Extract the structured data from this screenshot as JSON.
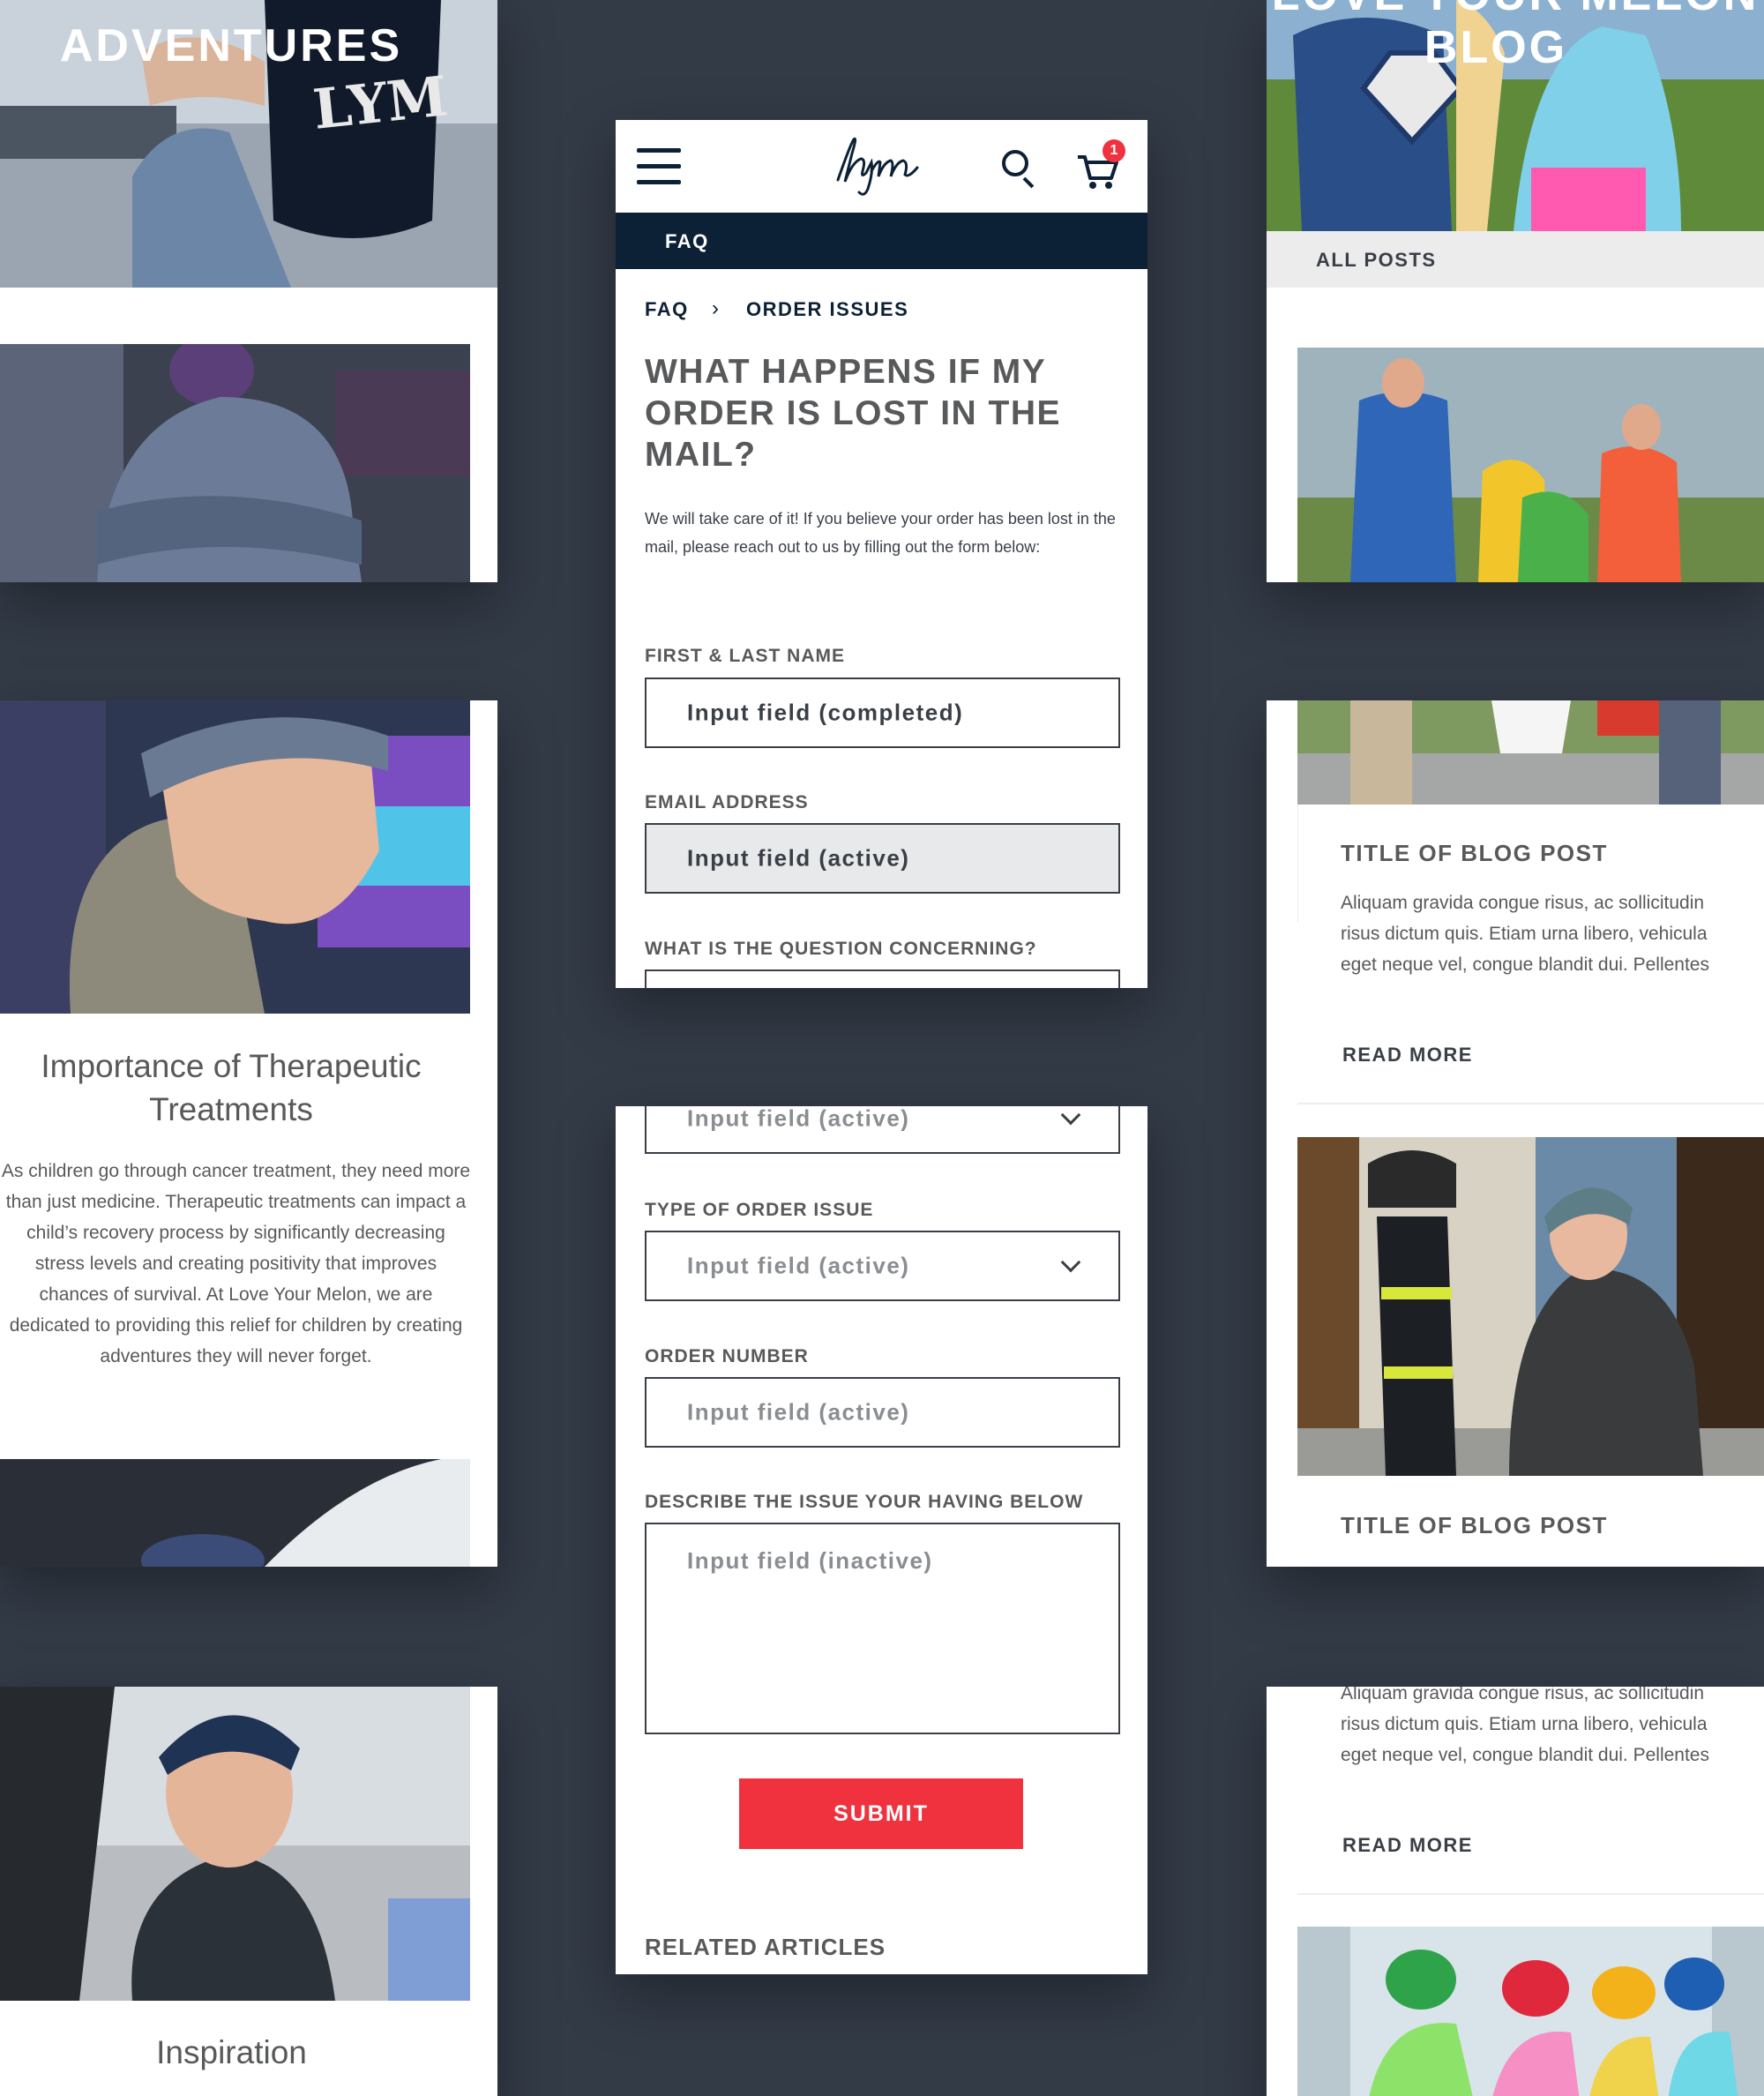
{
  "left": {
    "adventures_title": "ADVENTURES",
    "hat_text": "LYM",
    "article_title": "Importance of Therapeutic Treatments",
    "article_body": "As children go through cancer treatment, they need more than just medicine. Therapeutic treatments can impact a child’s recovery process by significantly decreasing stress levels and creating positivity that improves chances of survival. At Love Your Melon, we are dedicated to providing this relief for children by creating adventures they will never forget.",
    "inspiration_title": "Inspiration"
  },
  "phone": {
    "cart_count": "1",
    "nav_label": "FAQ",
    "breadcrumb": {
      "root": "FAQ",
      "separator": "›",
      "current": "ORDER ISSUES"
    },
    "heading": "WHAT HAPPENS IF MY ORDER IS LOST IN THE MAIL?",
    "intro": "We will take care of it! If you believe your order has been lost in the mail, please reach out to us by filling out the form below:",
    "fields": {
      "name_label": "FIRST & LAST NAME",
      "name_value": "Input field (completed)",
      "email_label": "EMAIL ADDRESS",
      "email_value": "Input field (active)",
      "concern_label": "WHAT IS THE QUESTION CONCERNING?",
      "concern_value": "Input field (active)",
      "type_label": "TYPE OF ORDER ISSUE",
      "type_value": "Input field (active)",
      "order_label": "ORDER NUMBER",
      "order_value": "Input field (active)",
      "describe_label": "DESCRIBE THE ISSUE YOUR HAVING BELOW",
      "describe_value": "Input field (inactive)"
    },
    "submit_label": "SUBMIT",
    "related_label": "RELATED ARTICLES"
  },
  "right": {
    "blog_title_top": "LOVE YOUR MELON",
    "blog_title": "BLOG",
    "all_posts": "ALL POSTS",
    "post1_title": "TITLE OF BLOG POST",
    "post1_body": "Aliquam gravida congue risus, ac sollicitudin risus dictum quis. Etiam urna libero, vehicula eget neque vel, congue blandit dui. Pellentes",
    "post1_more": "READ MORE",
    "post2_title": "TITLE OF BLOG POST",
    "post2_body": "Aliquam gravida congue risus, ac sollicitudin risus dictum quis. Etiam urna libero, vehicula eget neque vel, congue blandit dui. Pellentes",
    "post2_more": "READ MORE"
  },
  "colors": {
    "background": "#333b47",
    "navy": "#0d2136",
    "submit_red": "#f0323e",
    "text_gray": "#58595b",
    "active_field": "#e7e9eb"
  },
  "icons": [
    "hamburger-menu-icon",
    "lym-logo",
    "search-icon",
    "cart-icon",
    "chevron-down-icon",
    "breadcrumb-chevron-icon"
  ]
}
